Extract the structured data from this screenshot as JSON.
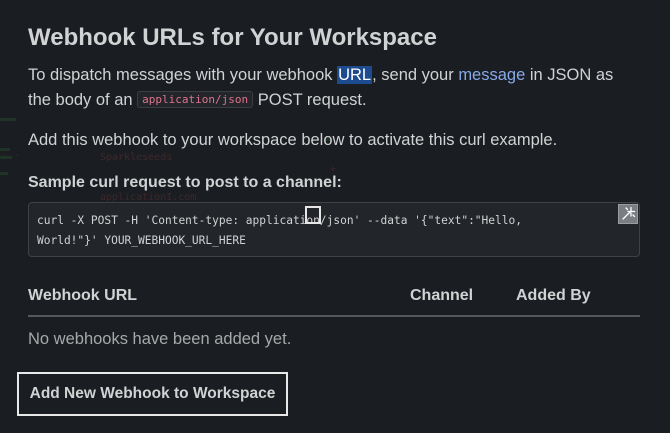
{
  "header": {
    "title": "Webhook URLs for Your Workspace"
  },
  "intro": {
    "part1": "To dispatch messages with your webhook ",
    "url_word": "URL",
    "part2": ", send your ",
    "message_link": "message",
    "part3": " in JSON as the body of an ",
    "inline_code": "application/json",
    "part4": " POST request."
  },
  "instructions": "Add this webhook to your workspace below to activate this curl example.",
  "sample": {
    "label": "Sample curl request to post to a channel:",
    "line1": "curl -X POST -H 'Content-type: application/json' --data '{\"text\":\"Hello,",
    "line2": "World!\"}' YOUR_WEBHOOK_URL_HERE",
    "copy_icon": "sparkle-copy-icon"
  },
  "table": {
    "columns": [
      "Webhook URL",
      "Channel",
      "Added By"
    ],
    "empty_message": "No webhooks have been added yet."
  },
  "actions": {
    "add_button": "Add New Webhook to Workspace"
  },
  "colors": {
    "background": "#1a1d21",
    "text": "#d1d2d3",
    "link": "#86a9e8",
    "highlight": "#1d4b8f",
    "inline_code": "#e0728b"
  }
}
